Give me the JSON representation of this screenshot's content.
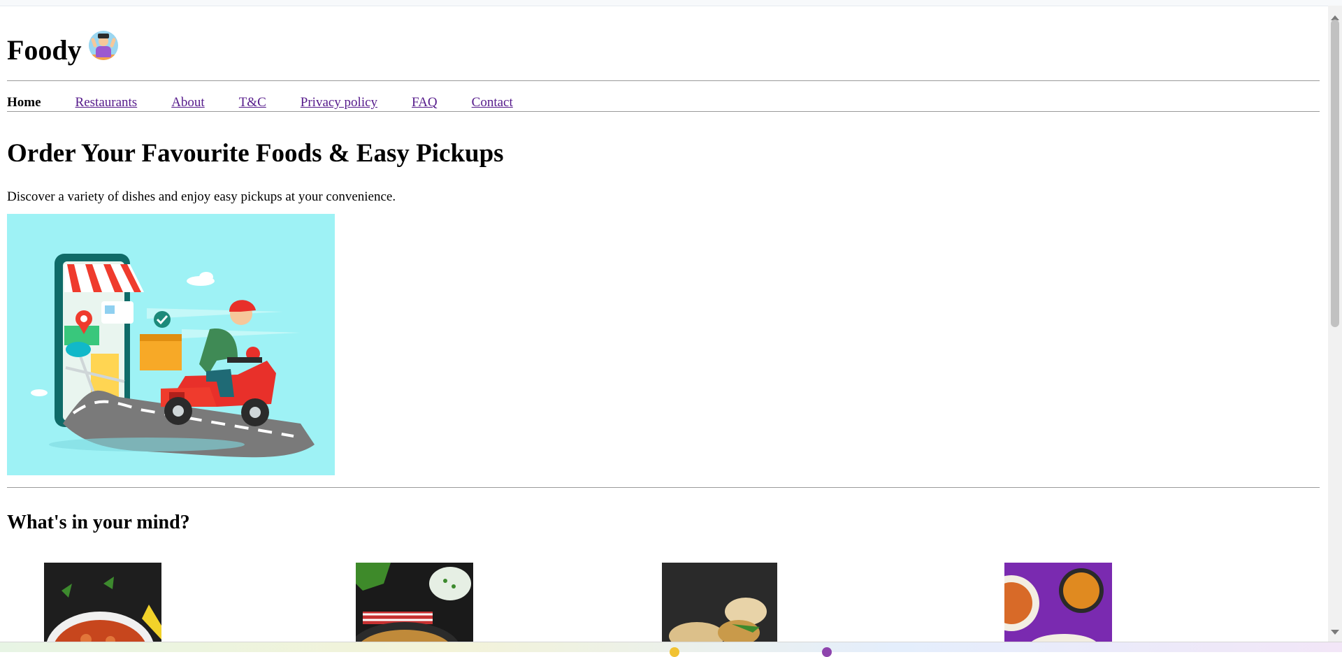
{
  "brand": {
    "name": "Foody",
    "logo_icon": "chef-mascot-icon"
  },
  "nav": {
    "items": [
      {
        "label": "Home",
        "active": true
      },
      {
        "label": "Restaurants",
        "active": false
      },
      {
        "label": "About",
        "active": false
      },
      {
        "label": "T&C",
        "active": false
      },
      {
        "label": "Privacy policy",
        "active": false
      },
      {
        "label": "FAQ",
        "active": false
      },
      {
        "label": "Contact",
        "active": false
      }
    ]
  },
  "hero": {
    "title": "Order Your Favourite Foods & Easy Pickups",
    "subtitle": "Discover a variety of dishes and enjoy easy pickups at your convenience.",
    "image": "delivery-scooter-illustration"
  },
  "categories": {
    "title": "What's in your mind?",
    "items": [
      {
        "image": "curry-pot-photo"
      },
      {
        "image": "biryani-raita-photo"
      },
      {
        "image": "vada-pav-photo"
      },
      {
        "image": "misal-pav-photo"
      }
    ]
  },
  "colors": {
    "link": "#551a8b",
    "hero_bg": "#9ef2f5",
    "rule": "#9a9a9a"
  }
}
